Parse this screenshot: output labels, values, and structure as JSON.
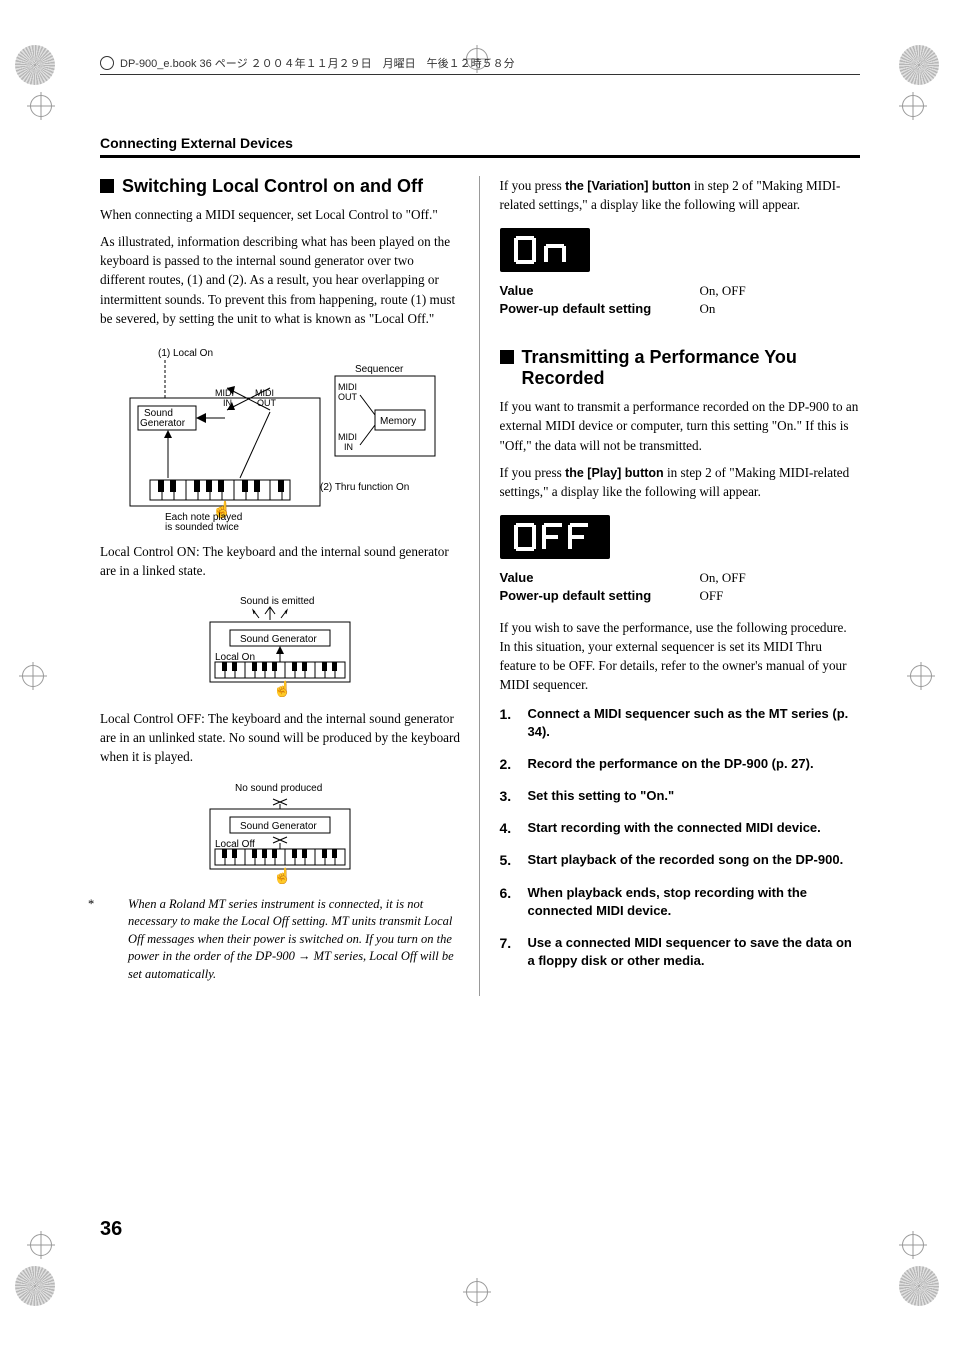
{
  "header": {
    "file_info": "DP-900_e.book 36 ページ ２００４年１１月２９日　月曜日　午後１２時５８分"
  },
  "section_header": "Connecting External Devices",
  "left": {
    "h_switch": "Switching Local Control on and Off",
    "p1": "When connecting a MIDI sequencer, set Local Control to \"Off.\"",
    "p2": "As illustrated, information describing what has been played on the keyboard is passed to the internal sound generator over two different routes, (1) and (2). As a result, you hear overlapping or intermittent sounds. To prevent this from happening, route (1) must be severed, by setting the unit to what is known as \"Local Off.\"",
    "diag1": {
      "local_on": "(1) Local On",
      "sound_generator": "Sound\nGenerator",
      "midi_in": "MIDI\nIN",
      "midi_out": "MIDI\nOUT",
      "sequencer": "Sequencer",
      "memory": "Memory",
      "each_note": "Each note played\nis sounded twice",
      "thru": "(2) Thru function On"
    },
    "p3": "Local Control ON: The keyboard and the internal sound generator are in a linked state.",
    "diag2": {
      "title": "Sound is emitted",
      "sg": "Sound Generator",
      "local": "Local On"
    },
    "p4": "Local Control OFF: The keyboard and the internal sound generator are in an unlinked state. No sound will be produced by the keyboard when it is played.",
    "diag3": {
      "title": "No sound produced",
      "sg": "Sound Generator",
      "local": "Local Off"
    },
    "note": "When a Roland MT series instrument is connected, it is not necessary to make the Local Off setting. MT units transmit Local Off messages when their power is switched on. If you turn on the power in the order of the DP-900 → MT series, Local Off will be set automatically."
  },
  "right": {
    "p_intro_a": "If you press ",
    "p_intro_bold": "the [Variation] button",
    "p_intro_b": " in step 2 of \"Making MIDI-related settings,\" a display like the following will appear.",
    "lcd1": "On",
    "kv1_value_label": "Value",
    "kv1_value": "On, OFF",
    "kv1_default_label": "Power-up default setting",
    "kv1_default": "On",
    "h_transmit": "Transmitting a Performance You Recorded",
    "p_t1": "If you want to transmit a performance recorded on the DP-900 to an external MIDI device or computer, turn this setting \"On.\" If this is \"Off,\" the data will not be transmitted.",
    "p_t2_a": "If you press ",
    "p_t2_bold": "the [Play] button",
    "p_t2_b": " in step 2 of \"Making MIDI-related settings,\" a display like the following will appear.",
    "lcd2": "OFF",
    "kv2_value_label": "Value",
    "kv2_value": "On, OFF",
    "kv2_default_label": "Power-up default setting",
    "kv2_default": "OFF",
    "p_t3": "If you wish to save the performance, use the following procedure. In this situation, your external sequencer is set its MIDI Thru feature to be OFF. For details, refer to the owner's manual of your MIDI sequencer.",
    "steps": [
      "Connect a MIDI sequencer such as the MT series (p. 34).",
      "Record the performance on the DP-900 (p. 27).",
      "Set this setting to \"On.\"",
      "Start recording with the connected MIDI device.",
      "Start playback of the recorded song on the DP-900.",
      "When playback ends, stop recording with the connected MIDI device.",
      "Use a connected MIDI sequencer to save the data on a floppy disk or other media."
    ]
  },
  "page_number": "36"
}
